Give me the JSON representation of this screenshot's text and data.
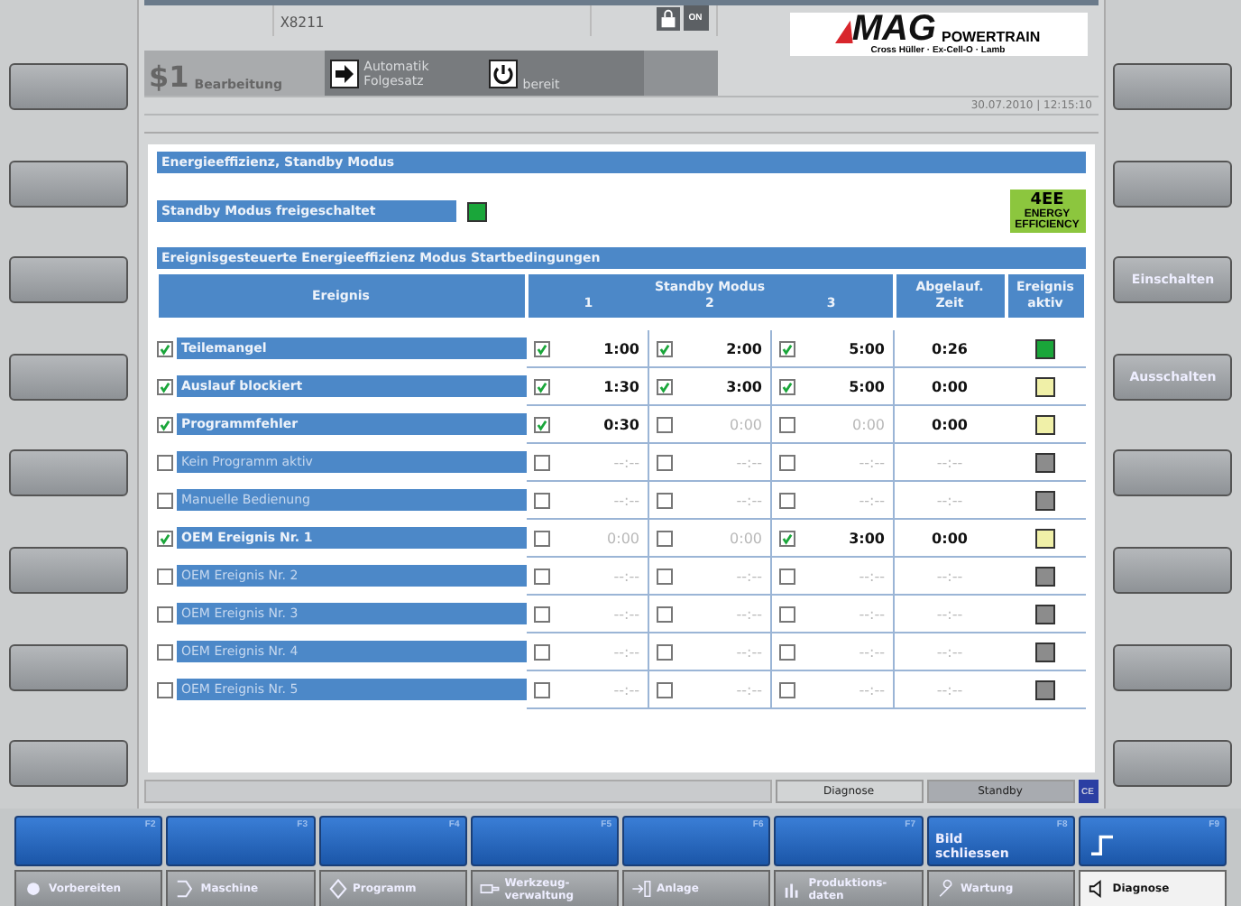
{
  "header": {
    "machine": "X8211",
    "channel": "$1",
    "channel_label": "Bearbeitung",
    "mode_lines": [
      "Automatik",
      "Folgesatz"
    ],
    "status": "bereit",
    "datetime": "30.07.2010 | 12:15:10",
    "lock_icon_label": "ON",
    "logo": {
      "brand": "MAG",
      "tagline": "POWERTRAIN",
      "subtitle": "Cross Hüller · Ex-Cell-O · Lamb"
    }
  },
  "page_title": "Energieeffizienz, Standby Modus",
  "standby_enable": {
    "label": "Standby Modus freigeschaltet",
    "on": true
  },
  "badge": {
    "title": "4EE",
    "subtitle": "ENERGY EFFICIENCY"
  },
  "section_title": "Ereignisgesteuerte Energieeffizienz Modus Startbedingungen",
  "table": {
    "columns": {
      "event": "Ereignis",
      "modes": "Standby Modus",
      "mode_numbers": [
        "1",
        "2",
        "3"
      ],
      "elapsed": [
        "Abgelauf.",
        "Zeit"
      ],
      "active": [
        "Ereignis",
        "aktiv"
      ]
    },
    "rows": [
      {
        "name": "Teilemangel",
        "checked": true,
        "modes": [
          {
            "checked": true,
            "time": "1:00"
          },
          {
            "checked": true,
            "time": "2:00"
          },
          {
            "checked": true,
            "time": "5:00"
          }
        ],
        "elapsed": "0:26",
        "color": "#1aa63a"
      },
      {
        "name": "Auslauf blockiert",
        "checked": true,
        "modes": [
          {
            "checked": true,
            "time": "1:30"
          },
          {
            "checked": true,
            "time": "3:00"
          },
          {
            "checked": true,
            "time": "5:00"
          }
        ],
        "elapsed": "0:00",
        "color": "#f0f0a8"
      },
      {
        "name": "Programmfehler",
        "checked": true,
        "modes": [
          {
            "checked": true,
            "time": "0:30"
          },
          {
            "checked": false,
            "time": "0:00"
          },
          {
            "checked": false,
            "time": "0:00"
          }
        ],
        "elapsed": "0:00",
        "color": "#f0f0a8"
      },
      {
        "name": "Kein Programm aktiv",
        "checked": false,
        "modes": [
          {
            "checked": false,
            "time": "--:--"
          },
          {
            "checked": false,
            "time": "--:--"
          },
          {
            "checked": false,
            "time": "--:--"
          }
        ],
        "elapsed": "--:--",
        "color": "#8c8c8c"
      },
      {
        "name": "Manuelle Bedienung",
        "checked": false,
        "modes": [
          {
            "checked": false,
            "time": "--:--"
          },
          {
            "checked": false,
            "time": "--:--"
          },
          {
            "checked": false,
            "time": "--:--"
          }
        ],
        "elapsed": "--:--",
        "color": "#8c8c8c"
      },
      {
        "name": "OEM Ereignis Nr. 1",
        "checked": true,
        "modes": [
          {
            "checked": false,
            "time": "0:00"
          },
          {
            "checked": false,
            "time": "0:00"
          },
          {
            "checked": true,
            "time": "3:00"
          }
        ],
        "elapsed": "0:00",
        "color": "#f0f0a8"
      },
      {
        "name": "OEM Ereignis Nr. 2",
        "checked": false,
        "modes": [
          {
            "checked": false,
            "time": "--:--"
          },
          {
            "checked": false,
            "time": "--:--"
          },
          {
            "checked": false,
            "time": "--:--"
          }
        ],
        "elapsed": "--:--",
        "color": "#8c8c8c"
      },
      {
        "name": "OEM Ereignis Nr. 3",
        "checked": false,
        "modes": [
          {
            "checked": false,
            "time": "--:--"
          },
          {
            "checked": false,
            "time": "--:--"
          },
          {
            "checked": false,
            "time": "--:--"
          }
        ],
        "elapsed": "--:--",
        "color": "#8c8c8c"
      },
      {
        "name": "OEM Ereignis Nr. 4",
        "checked": false,
        "modes": [
          {
            "checked": false,
            "time": "--:--"
          },
          {
            "checked": false,
            "time": "--:--"
          },
          {
            "checked": false,
            "time": "--:--"
          }
        ],
        "elapsed": "--:--",
        "color": "#8c8c8c"
      },
      {
        "name": "OEM Ereignis Nr. 5",
        "checked": false,
        "modes": [
          {
            "checked": false,
            "time": "--:--"
          },
          {
            "checked": false,
            "time": "--:--"
          },
          {
            "checked": false,
            "time": "--:--"
          }
        ],
        "elapsed": "--:--",
        "color": "#8c8c8c"
      }
    ]
  },
  "right_softkeys": [
    {
      "label": "Einschalten"
    },
    {
      "label": "Ausschalten"
    }
  ],
  "status_bar": {
    "buttons": [
      {
        "label": "Diagnose",
        "selected": false
      },
      {
        "label": "Standby",
        "selected": true
      }
    ],
    "mark": "CE"
  },
  "function_keys": [
    {
      "key": "F2",
      "kind": "blank"
    },
    {
      "key": "F3",
      "kind": "blank"
    },
    {
      "key": "F4",
      "kind": "blank"
    },
    {
      "key": "F5",
      "kind": "blank"
    },
    {
      "key": "F6",
      "kind": "blank"
    },
    {
      "key": "F7",
      "kind": "blank"
    },
    {
      "key": "F8",
      "kind": "label",
      "label": "Bild schliessen"
    },
    {
      "key": "F9",
      "kind": "icon"
    }
  ],
  "nav_tabs": [
    {
      "label": "Vorbereiten",
      "selected": false
    },
    {
      "label": "Maschine",
      "selected": false
    },
    {
      "label": "Programm",
      "selected": false
    },
    {
      "label": "Werkzeug-verwaltung",
      "selected": false
    },
    {
      "label": "Anlage",
      "selected": false
    },
    {
      "label": "Produktions-daten",
      "selected": false
    },
    {
      "label": "Wartung",
      "selected": false
    },
    {
      "label": "Diagnose",
      "selected": true
    }
  ]
}
